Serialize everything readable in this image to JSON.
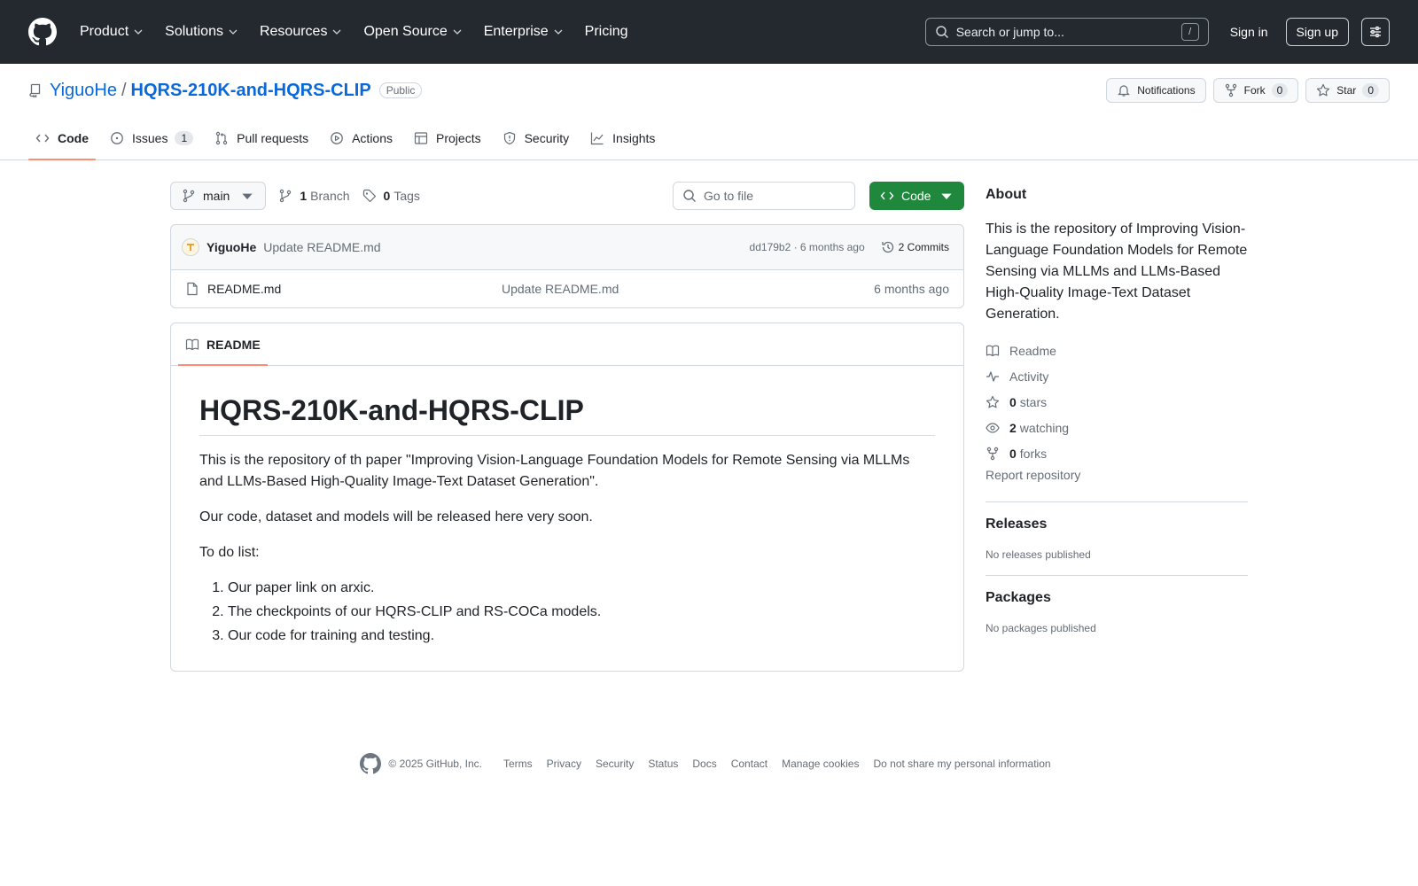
{
  "header": {
    "nav": [
      "Product",
      "Solutions",
      "Resources",
      "Open Source",
      "Enterprise",
      "Pricing"
    ],
    "search_placeholder": "Search or jump to...",
    "search_shortcut": "/",
    "sign_in": "Sign in",
    "sign_up": "Sign up"
  },
  "repo": {
    "owner": "YiguoHe",
    "separator": "/",
    "name": "HQRS-210K-and-HQRS-CLIP",
    "visibility": "Public",
    "notifications_label": "Notifications",
    "fork_label": "Fork",
    "fork_count": "0",
    "star_label": "Star",
    "star_count": "0"
  },
  "tabs": [
    {
      "label": "Code",
      "icon": "code-icon",
      "active": true
    },
    {
      "label": "Issues",
      "icon": "issue-opened-icon",
      "count": "1"
    },
    {
      "label": "Pull requests",
      "icon": "git-pull-request-icon"
    },
    {
      "label": "Actions",
      "icon": "play-icon"
    },
    {
      "label": "Projects",
      "icon": "table-icon"
    },
    {
      "label": "Security",
      "icon": "shield-icon"
    },
    {
      "label": "Insights",
      "icon": "graph-icon"
    }
  ],
  "file_nav": {
    "branch": "main",
    "branch_count": "1",
    "branch_label": "Branch",
    "tag_count": "0",
    "tag_label": "Tags",
    "goto_placeholder": "Go to file",
    "code_button": "Code"
  },
  "latest_commit": {
    "author": "YiguoHe",
    "message": "Update README.md",
    "meta": "dd179b2 · 6 months ago",
    "commits_label": "2 Commits"
  },
  "files": [
    {
      "name": "README.md",
      "message": "Update README.md",
      "age": "6 months ago"
    }
  ],
  "readme": {
    "tab_label": "README",
    "title": "HQRS-210K-and-HQRS-CLIP",
    "para1": "This is the repository of th paper \"Improving Vision-Language Foundation Models for Remote Sensing via MLLMs and LLMs-Based High-Quality Image-Text Dataset Generation\".",
    "para2": "Our code, dataset and models will be released here very soon.",
    "para3": "To do list:",
    "todo": [
      "Our paper link on arxic.",
      "The checkpoints of our HQRS-CLIP and RS-COCa models.",
      "Our code for training and testing."
    ]
  },
  "about": {
    "heading": "About",
    "description": "This is the repository of Improving Vision-Language Foundation Models for Remote Sensing via MLLMs and LLMs-Based High-Quality Image-Text Dataset Generation.",
    "readme_link": "Readme",
    "activity_link": "Activity",
    "stars_count": "0",
    "stars_label": "stars",
    "watching_count": "2",
    "watching_label": "watching",
    "forks_count": "0",
    "forks_label": "forks",
    "report": "Report repository"
  },
  "releases": {
    "heading": "Releases",
    "empty": "No releases published"
  },
  "packages": {
    "heading": "Packages",
    "empty": "No packages published"
  },
  "footer": {
    "copyright": "© 2025 GitHub, Inc.",
    "links": [
      "Terms",
      "Privacy",
      "Security",
      "Status",
      "Docs",
      "Contact",
      "Manage cookies",
      "Do not share my personal information"
    ]
  },
  "colors": {
    "header_bg": "#24292f",
    "link": "#0969da",
    "primary_button": "#1f883d",
    "active_underline": "#fd8c73"
  }
}
